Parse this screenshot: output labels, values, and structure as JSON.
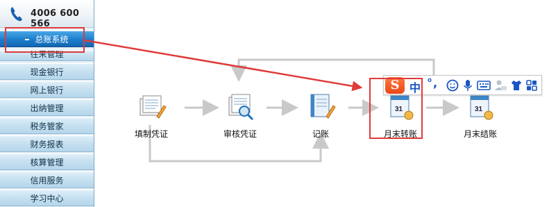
{
  "phone": "4006 600 566",
  "nav": {
    "active": "总账系统",
    "items": [
      "往来管理",
      "现金银行",
      "网上银行",
      "出纳管理",
      "税务管家",
      "财务报表",
      "核算管理",
      "信用服务",
      "学习中心"
    ]
  },
  "workflow": {
    "steps": [
      "填制凭证",
      "审核凭证",
      "记账",
      "月末转账",
      "月末结账"
    ]
  },
  "ime": {
    "logo": "S",
    "mode": "中",
    "punct": "°,",
    "icons": [
      "emoji-icon",
      "microphone-icon",
      "keyboard-icon",
      "user-icon",
      "shirt-icon",
      "grid-icon"
    ]
  },
  "colors": {
    "highlight": "#e03a3a",
    "nav_active": "#1b7dcc",
    "ime_accent": "#1a55c2",
    "ime_logo": "#e8481a"
  }
}
